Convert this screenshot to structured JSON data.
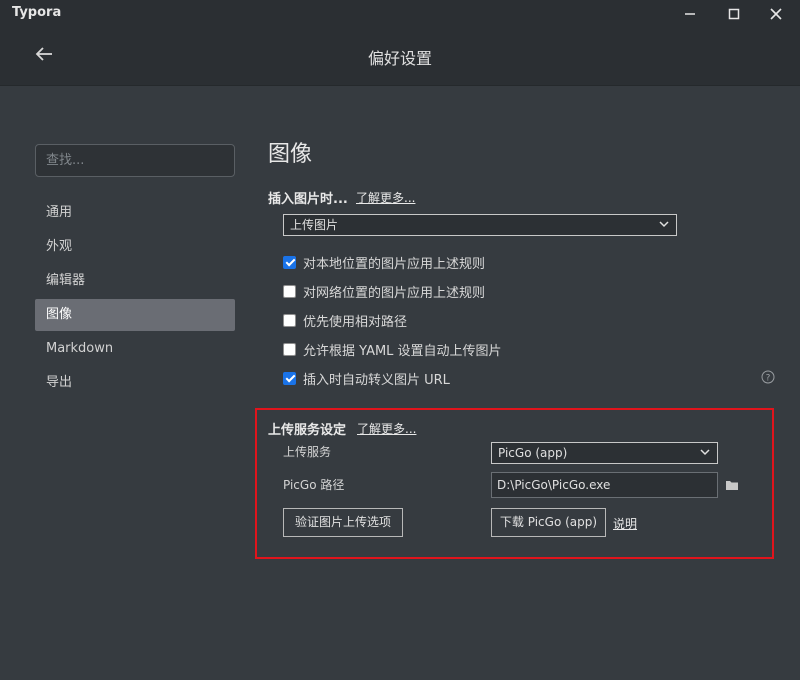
{
  "app": {
    "title": "Typora"
  },
  "header": {
    "title": "偏好设置"
  },
  "sidebar": {
    "search_placeholder": "查找...",
    "items": [
      {
        "label": "通用"
      },
      {
        "label": "外观"
      },
      {
        "label": "编辑器"
      },
      {
        "label": "图像",
        "active": true
      },
      {
        "label": "Markdown"
      },
      {
        "label": "导出"
      }
    ]
  },
  "main": {
    "section_title": "图像",
    "insert": {
      "label": "插入图片时...",
      "learn_more": "了解更多...",
      "selected": "上传图片"
    },
    "checkboxes": [
      {
        "label": "对本地位置的图片应用上述规则",
        "checked": true
      },
      {
        "label": "对网络位置的图片应用上述规则",
        "checked": false
      },
      {
        "label": "优先使用相对路径",
        "checked": false
      },
      {
        "label": "允许根据 YAML 设置自动上传图片",
        "checked": false
      },
      {
        "label": "插入时自动转义图片 URL",
        "checked": true
      }
    ],
    "upload": {
      "label": "上传服务设定",
      "learn_more": "了解更多...",
      "service_label": "上传服务",
      "service_value": "PicGo (app)",
      "path_label": "PicGo 路径",
      "path_value": "D:\\PicGo\\PicGo.exe",
      "verify_button": "验证图片上传选项",
      "download_button": "下载 PicGo (app)",
      "explain_link": "说明"
    }
  },
  "colors": {
    "highlight_border": "#e0141c",
    "checkbox_checked": "#1a73e8",
    "active_nav": "#6a6d74"
  }
}
